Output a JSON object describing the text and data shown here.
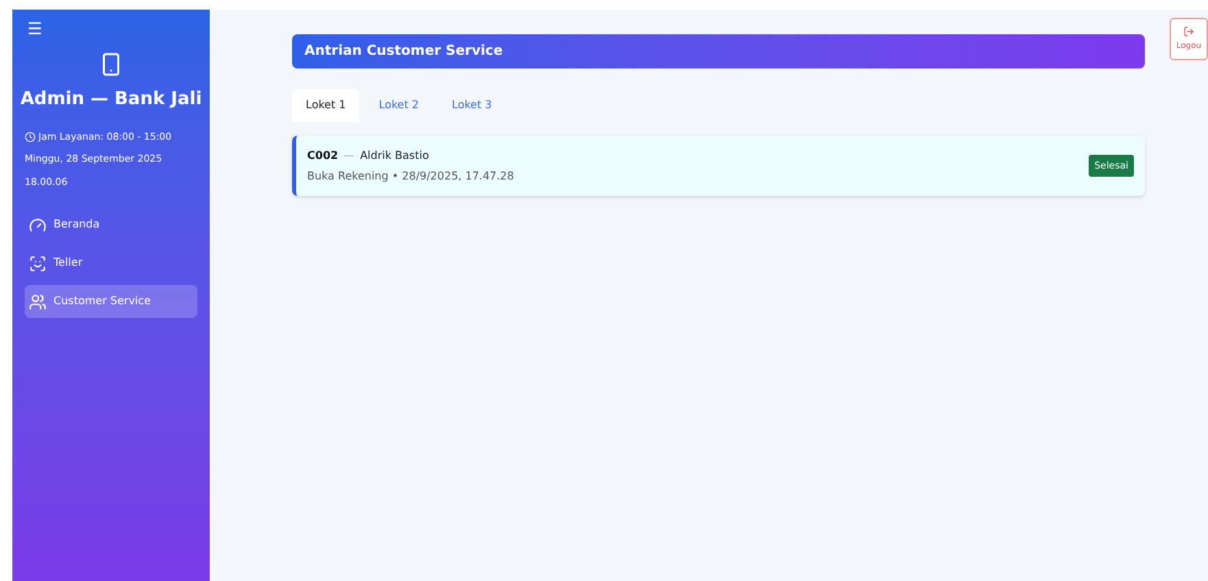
{
  "sidebar": {
    "menu_icon": "☰",
    "title": "Admin — Bank Jali",
    "service_hours": "Jam Layanan: 08:00 - 15:00",
    "date": "Minggu, 28 September 2025",
    "time": "18.00.06",
    "items": [
      {
        "label": "Beranda",
        "kind": "gauge",
        "selected": false
      },
      {
        "label": "Teller",
        "kind": "teller",
        "selected": false
      },
      {
        "label": "Customer Service",
        "kind": "users",
        "selected": true
      }
    ]
  },
  "header": {
    "title": "Antrian Customer Service"
  },
  "tabs": [
    {
      "label": "Loket 1",
      "selected": true
    },
    {
      "label": "Loket 2",
      "selected": false
    },
    {
      "label": "Loket 3",
      "selected": false
    }
  ],
  "queue": [
    {
      "code": "C002",
      "separator": "—",
      "name": "Aldrik Bastio",
      "detail": "Buka Rekening • 28/9/2025, 17.47.28",
      "status": "Selesai"
    }
  ],
  "logout": {
    "label": "Logou"
  }
}
